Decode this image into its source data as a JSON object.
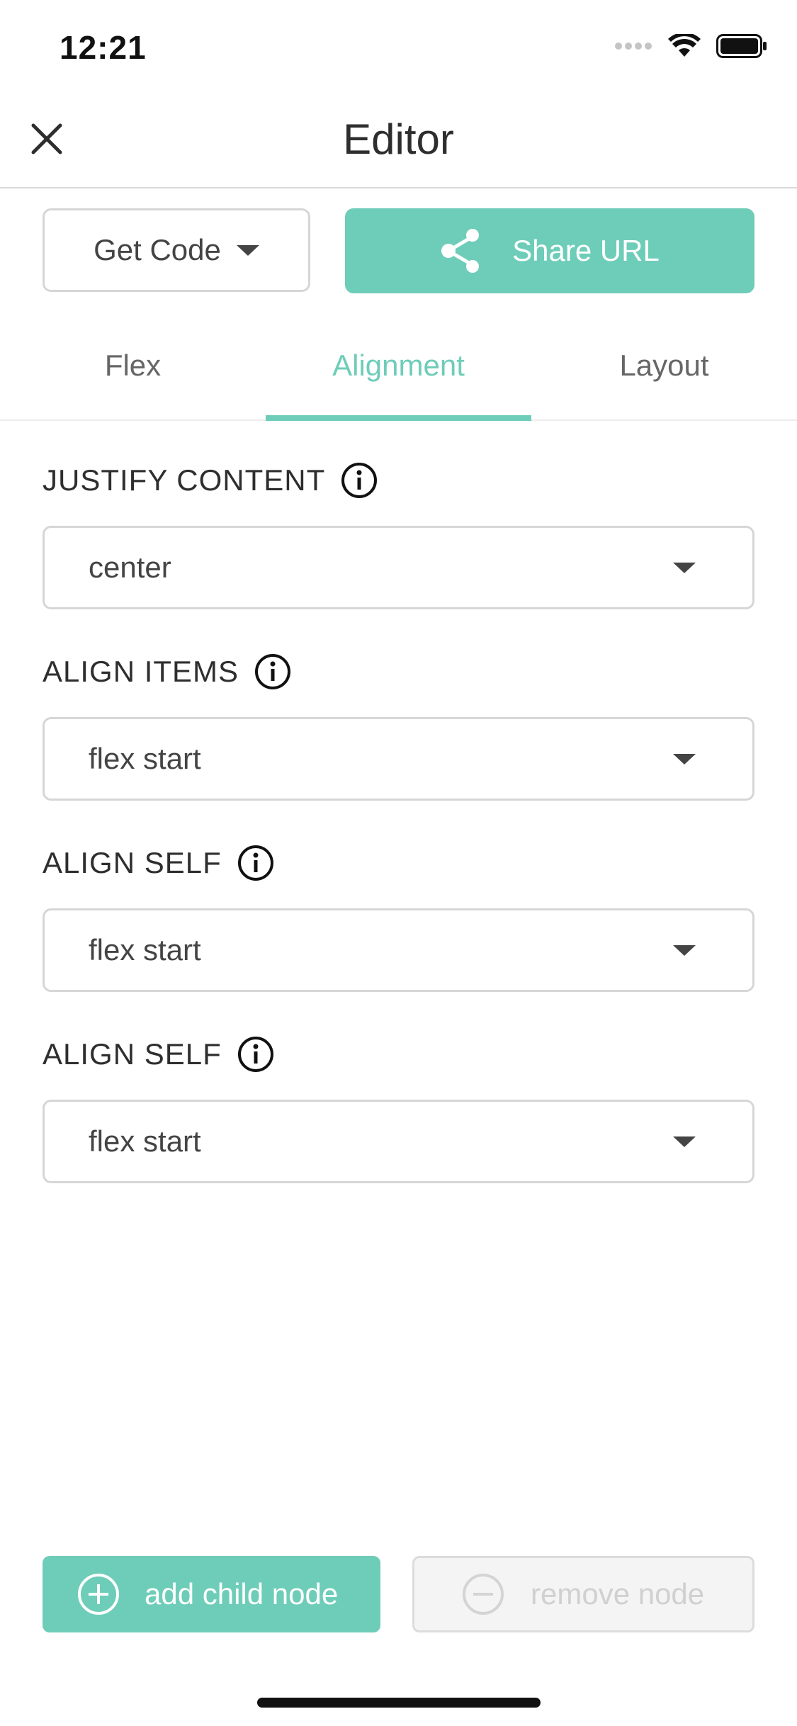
{
  "status_bar": {
    "time": "12:21"
  },
  "header": {
    "title": "Editor",
    "close_icon": "close-icon"
  },
  "toolbar": {
    "get_code_label": "Get Code",
    "share_label": "Share URL",
    "share_icon": "share-icon"
  },
  "tabs": [
    {
      "label": "Flex",
      "active": false
    },
    {
      "label": "Alignment",
      "active": true
    },
    {
      "label": "Layout",
      "active": false
    }
  ],
  "fields": [
    {
      "label": "JUSTIFY CONTENT",
      "value": "center"
    },
    {
      "label": "ALIGN ITEMS",
      "value": "flex start"
    },
    {
      "label": "ALIGN SELF",
      "value": "flex start"
    },
    {
      "label": "ALIGN SELF",
      "value": "flex start"
    }
  ],
  "actions": {
    "add_label": "add child node",
    "remove_label": "remove node",
    "remove_enabled": false
  },
  "colors": {
    "accent": "#6ecdb8",
    "text": "#333333",
    "border": "#d6d6d6",
    "disabled_text": "#d0d0d0"
  }
}
